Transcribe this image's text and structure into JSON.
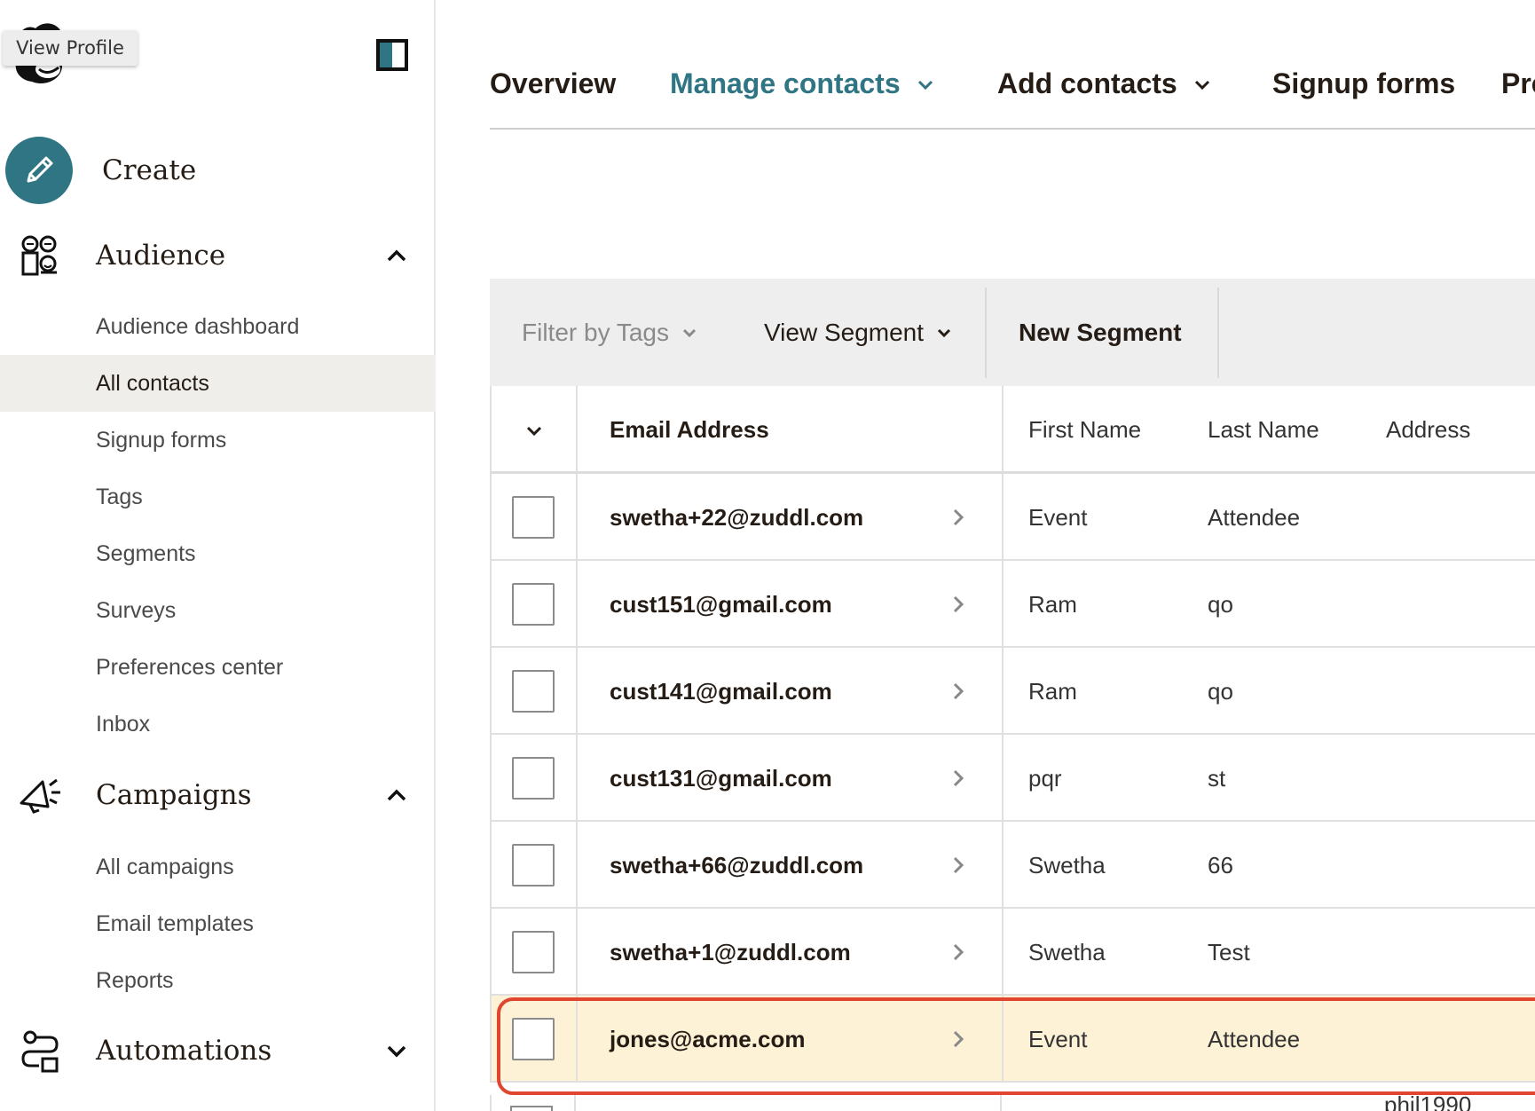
{
  "sidebar": {
    "tooltip": "View Profile",
    "create_label": "Create",
    "sections": {
      "audience": {
        "label": "Audience",
        "items": [
          "Audience dashboard",
          "All contacts",
          "Signup forms",
          "Tags",
          "Segments",
          "Surveys",
          "Preferences center",
          "Inbox"
        ],
        "active": "All contacts"
      },
      "campaigns": {
        "label": "Campaigns",
        "items": [
          "All campaigns",
          "Email templates",
          "Reports"
        ]
      },
      "automations": {
        "label": "Automations"
      }
    }
  },
  "tabs": [
    {
      "label": "Overview"
    },
    {
      "label": "Manage contacts"
    },
    {
      "label": "Add contacts"
    },
    {
      "label": "Signup forms"
    },
    {
      "label": "Pre"
    }
  ],
  "toolbar": {
    "filter_tags": "Filter by Tags",
    "view_segment": "View Segment",
    "new_segment": "New Segment"
  },
  "table": {
    "columns": [
      "Email Address",
      "First Name",
      "Last Name",
      "Address"
    ],
    "rows": [
      {
        "email": "swetha+22@zuddl.com",
        "first": "Event",
        "last": "Attendee"
      },
      {
        "email": "cust151@gmail.com",
        "first": "Ram",
        "last": "qo"
      },
      {
        "email": "cust141@gmail.com",
        "first": "Ram",
        "last": "qo"
      },
      {
        "email": "cust131@gmail.com",
        "first": "pqr",
        "last": "st"
      },
      {
        "email": "swetha+66@zuddl.com",
        "first": "Swetha",
        "last": "66"
      },
      {
        "email": "swetha+1@zuddl.com",
        "first": "Swetha",
        "last": "Test"
      },
      {
        "email": "jones@acme.com",
        "first": "Event",
        "last": "Attendee"
      }
    ],
    "partial_address": "phil1990"
  },
  "colors": {
    "accent": "#2f7584",
    "highlight_bg": "#fdf2d6",
    "highlight_border": "#e0452f",
    "active_nav_bg": "#efeeea"
  }
}
